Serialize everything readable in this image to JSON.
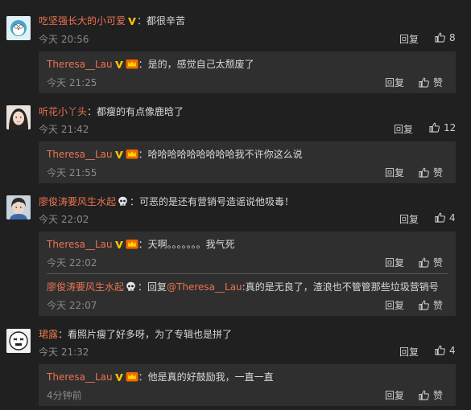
{
  "labels": {
    "reply": "回复",
    "like": "赞"
  },
  "comments": [
    {
      "username": "吃坚强长大的小可爱",
      "text": "：都很辛苦",
      "time": "今天 20:56",
      "likes": "8",
      "replies": [
        {
          "username": "Theresa__Lau",
          "text": "：是的，感觉自己太颓废了",
          "time": "今天 21:25"
        }
      ]
    },
    {
      "username": "听花小丫头",
      "text": "：都瘦的有点像鹿晗了",
      "time": "今天 21:42",
      "likes": "12",
      "replies": [
        {
          "username": "Theresa__Lau",
          "text": "：哈哈哈哈哈哈哈哈哈我不许你这么说",
          "time": "今天 21:55"
        }
      ]
    },
    {
      "username": "廖俊涛要风生水起",
      "text": "：可恶的是还有营销号造谣说他吸毒！",
      "time": "今天 22:02",
      "likes": "4",
      "replies": [
        {
          "username": "Theresa__Lau",
          "text": "：天啊。。。。。。。我气死",
          "time": "今天 22:02"
        },
        {
          "username": "廖俊涛要风生水起",
          "pre": "：回复",
          "mention": "@Theresa__Lau",
          "text": ":真的是无良了，渣浪也不管管那些垃圾营销号",
          "time": "今天 22:07"
        }
      ]
    },
    {
      "username": "珺露",
      "text": "：看照片瘦了好多呀，为了专辑也是拼了",
      "time": "今天 21:32",
      "likes": "4",
      "replies": [
        {
          "username": "Theresa__Lau",
          "text": "：他是真的好鼓励我，一直一直",
          "time": "4分钟前"
        }
      ]
    }
  ]
}
